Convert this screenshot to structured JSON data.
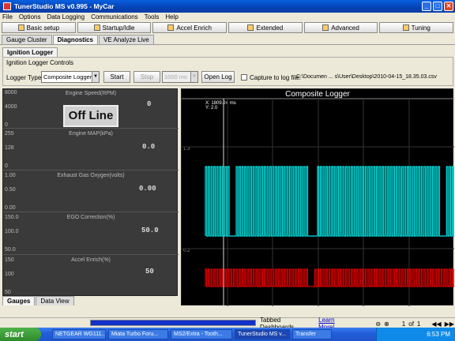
{
  "window": {
    "title": "TunerStudio MS v0.995 - MyCar"
  },
  "menu": [
    "File",
    "Options",
    "Data Logging",
    "Communications",
    "Tools",
    "Help"
  ],
  "toolbar": [
    {
      "label": "Basic setup",
      "icon": "wrench-icon"
    },
    {
      "label": "Startup/Idle",
      "icon": "key-icon"
    },
    {
      "label": "Accel Enrich",
      "icon": "car-icon"
    },
    {
      "label": "Extended",
      "icon": "gear-icon"
    },
    {
      "label": "Advanced",
      "icon": "gear-icon"
    },
    {
      "label": "Tuning",
      "icon": "tuning-icon"
    }
  ],
  "main_tabs": [
    "Gauge Cluster",
    "Diagnostics",
    "VE Analyze Live"
  ],
  "sub_tab": "Ignition Logger",
  "controls": {
    "group_title": "Ignition Logger Controls",
    "logger_type_label": "Logger Type:",
    "logger_type_value": "Composite Logger",
    "start": "Start",
    "stop": "Stop",
    "interval": "1000 ms",
    "open_log": "Open Log",
    "capture_label": "Capture to log file:",
    "capture_checked": false,
    "log_path": "C:\\Documen ... s\\User\\Desktop\\2010-04-15_18.35.03.csv"
  },
  "gauges": [
    {
      "title": "Engine Speed(RPM)",
      "value": "0",
      "scale": [
        "8000",
        "4000",
        "0"
      ]
    },
    {
      "title": "Engine MAP(kPa)",
      "value": "0.0",
      "scale": [
        "255",
        "128",
        "0"
      ]
    },
    {
      "title": "Exhaust Gas Oxygen(volts)",
      "value": "0.00",
      "scale": [
        "1.00",
        "0.50",
        "0.00"
      ]
    },
    {
      "title": "EGO Correction(%)",
      "value": "50.0",
      "scale": [
        "150.0",
        "100.0",
        "50.0"
      ]
    },
    {
      "title": "Accel Enrich(%)",
      "value": "50",
      "scale": [
        "150",
        "100",
        "50"
      ]
    }
  ],
  "offline": "Off Line",
  "gauge_tabs": [
    "Gauges",
    "Data View"
  ],
  "chart_data": {
    "type": "line",
    "title": "Composite Logger",
    "cursor": {
      "x_label": "X: 1809.24 ms",
      "y_label": "Y: 2.0"
    },
    "trace1_level_label": "1.3",
    "trace2_level_label": "0.2",
    "series": [
      {
        "color": "#00e5e5"
      },
      {
        "color": "#e00000"
      }
    ]
  },
  "plot_nav": {
    "page": "1",
    "of": "of",
    "total": "1"
  },
  "status": {
    "tabbed": "Tabbed Dashboards",
    "learn_more": "Learn More!"
  },
  "taskbar": {
    "start": "start",
    "tasks": [
      "NETGEAR WG111...",
      "Miata Turbo Foru...",
      "MS2/Extra - Tooth...",
      "TunerStudio MS v...",
      "Transfer"
    ],
    "time": "6:53 PM"
  },
  "colors": {
    "accent": "#0a5fe0",
    "cyan": "#00e5e5",
    "red": "#e00000",
    "plot_bg": "#000000"
  }
}
